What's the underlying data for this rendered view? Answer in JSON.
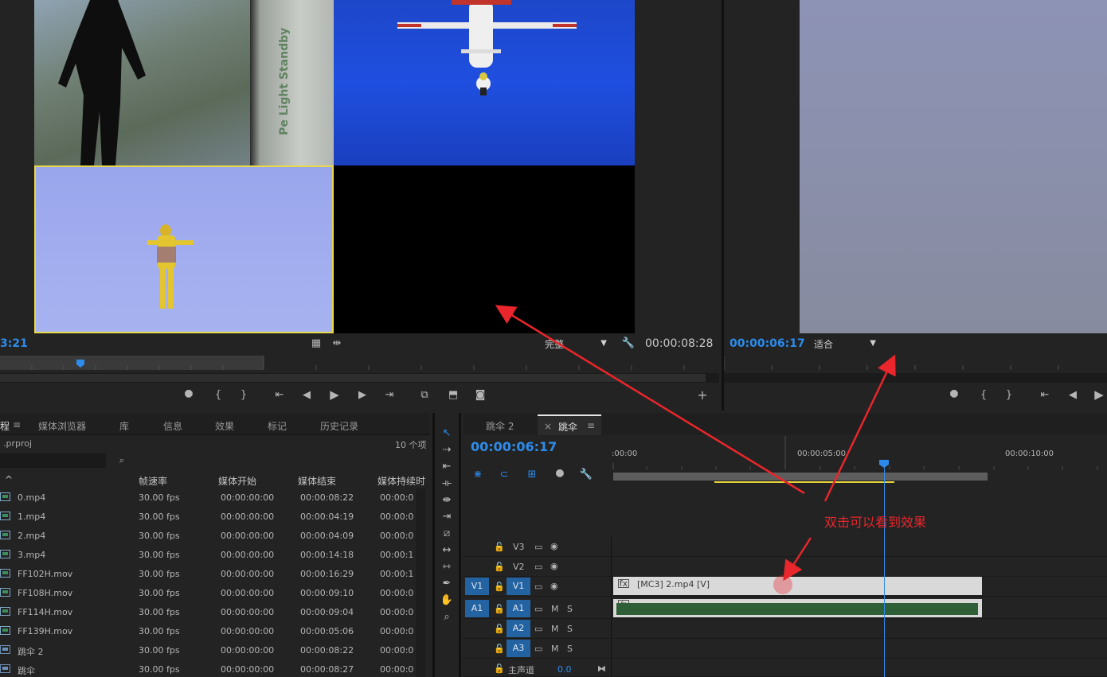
{
  "source_monitor": {
    "timecode_left": "3:21",
    "timecode_right": "00:00:08:28",
    "quality": "完整",
    "cam1_door_text": "Pe Light Standby"
  },
  "program_monitor": {
    "timecode": "00:00:06:17",
    "fit": "适合"
  },
  "project_panel": {
    "tab_partial": "程",
    "tabs": [
      "媒体浏览器",
      "库",
      "信息",
      "效果",
      "标记",
      "历史记录"
    ],
    "file": ".prproj",
    "count": "10 个项",
    "columns": [
      "帧速率",
      "媒体开始",
      "媒体结束",
      "媒体持续时"
    ],
    "rows": [
      {
        "name": "0.mp4",
        "fps": "30.00 fps",
        "start": "00:00:00:00",
        "end": "00:00:08:22",
        "dur": "00:00:0"
      },
      {
        "name": "1.mp4",
        "fps": "30.00 fps",
        "start": "00:00:00:00",
        "end": "00:00:04:19",
        "dur": "00:00:0"
      },
      {
        "name": "2.mp4",
        "fps": "30.00 fps",
        "start": "00:00:00:00",
        "end": "00:00:04:09",
        "dur": "00:00:0"
      },
      {
        "name": "3.mp4",
        "fps": "30.00 fps",
        "start": "00:00:00:00",
        "end": "00:00:14:18",
        "dur": "00:00:1"
      },
      {
        "name": "FF102H.mov",
        "fps": "30.00 fps",
        "start": "00:00:00:00",
        "end": "00:00:16:29",
        "dur": "00:00:1"
      },
      {
        "name": "FF108H.mov",
        "fps": "30.00 fps",
        "start": "00:00:00:00",
        "end": "00:00:09:10",
        "dur": "00:00:0"
      },
      {
        "name": "FF114H.mov",
        "fps": "30.00 fps",
        "start": "00:00:00:00",
        "end": "00:00:09:04",
        "dur": "00:00:0"
      },
      {
        "name": "FF139H.mov",
        "fps": "30.00 fps",
        "start": "00:00:00:00",
        "end": "00:00:05:06",
        "dur": "00:00:0"
      },
      {
        "name": "跳伞 2",
        "fps": "30.00 fps",
        "start": "00:00:00:00",
        "end": "00:00:08:22",
        "dur": "00:00:0"
      },
      {
        "name": "跳伞",
        "fps": "30.00 fps",
        "start": "00:00:00:00",
        "end": "00:00:08:27",
        "dur": "00:00:0"
      }
    ]
  },
  "timeline": {
    "tabs": [
      "跳伞 2",
      "跳伞"
    ],
    "timecode": "00:00:06:17",
    "ruler": [
      ":00:00",
      "00:00:05:00",
      "00:00:10:00"
    ],
    "tracks": {
      "v3": "V3",
      "v2": "V2",
      "v1_src": "V1",
      "v1": "V1",
      "a1_src": "A1",
      "a1": "A1",
      "a2": "A2",
      "a3": "A3",
      "master": "主声道",
      "master_val": "0.0",
      "m": "M",
      "s": "S"
    },
    "clip_video": "[MC3] 2.mp4 [V]"
  },
  "annotation": {
    "text": "双击可以看到效果",
    "color": "#e8262b"
  },
  "colors": {
    "accent_blue": "#2d8ceb",
    "selected_border": "#e8d84a",
    "panel_bg": "#232323"
  }
}
